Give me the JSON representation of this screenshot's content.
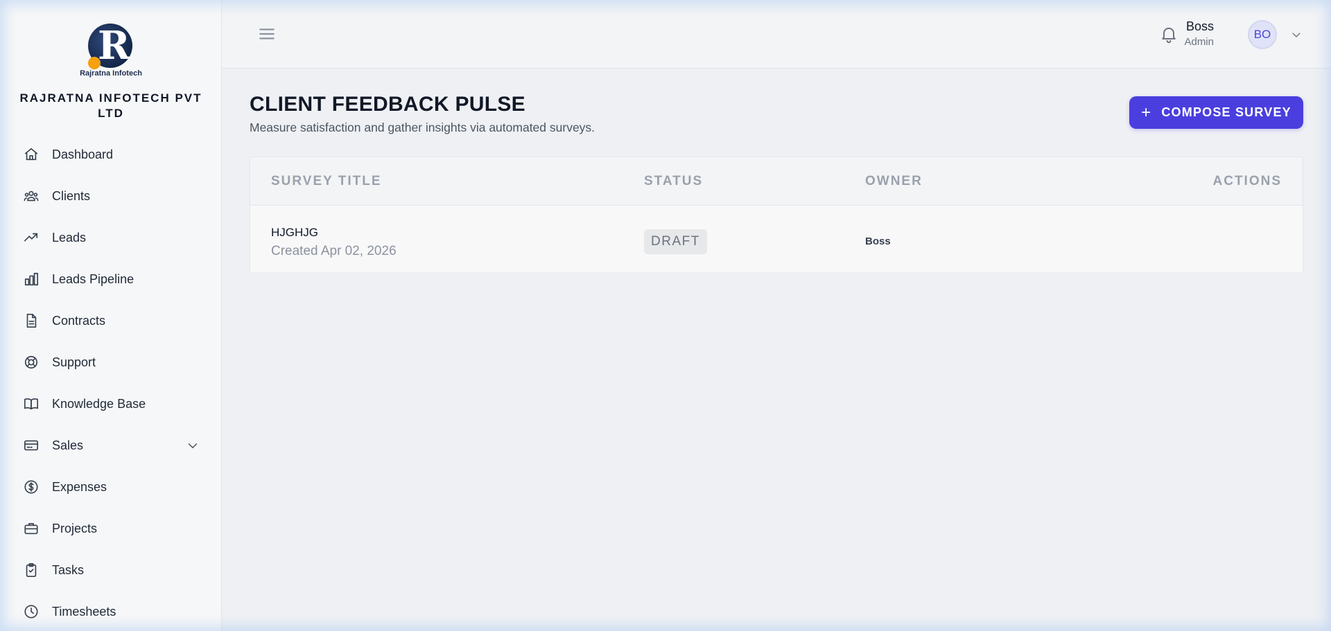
{
  "brand": {
    "logo_caption": "Rajratna Infotech",
    "company_name": "RAJRATNA INFOTECH PVT LTD",
    "logo_accent": "#f5a00f",
    "logo_primary": "#14264a"
  },
  "sidebar": {
    "items": [
      {
        "label": "Dashboard",
        "icon": "home-icon"
      },
      {
        "label": "Clients",
        "icon": "users-icon"
      },
      {
        "label": "Leads",
        "icon": "trending-up-icon"
      },
      {
        "label": "Leads Pipeline",
        "icon": "bar-chart-icon"
      },
      {
        "label": "Contracts",
        "icon": "document-icon"
      },
      {
        "label": "Support",
        "icon": "lifebuoy-icon"
      },
      {
        "label": "Knowledge Base",
        "icon": "book-icon"
      },
      {
        "label": "Sales",
        "icon": "credit-card-icon",
        "expandable": true
      },
      {
        "label": "Expenses",
        "icon": "dollar-circle-icon"
      },
      {
        "label": "Projects",
        "icon": "briefcase-icon"
      },
      {
        "label": "Tasks",
        "icon": "clipboard-check-icon"
      },
      {
        "label": "Timesheets",
        "icon": "clock-icon"
      }
    ]
  },
  "header": {
    "user_name": "Boss",
    "user_role": "Admin",
    "avatar_initials": "BO"
  },
  "main": {
    "title": "CLIENT FEEDBACK PULSE",
    "subtitle": "Measure satisfaction and gather insights via automated surveys.",
    "compose_button": "COMPOSE SURVEY",
    "accent_color": "#4a3fde",
    "table": {
      "columns": [
        "SURVEY TITLE",
        "STATUS",
        "OWNER",
        "ACTIONS"
      ],
      "rows": [
        {
          "title": "HJGHJG",
          "created": "Created Apr 02, 2026",
          "status": "DRAFT",
          "owner": "Boss"
        }
      ]
    }
  }
}
